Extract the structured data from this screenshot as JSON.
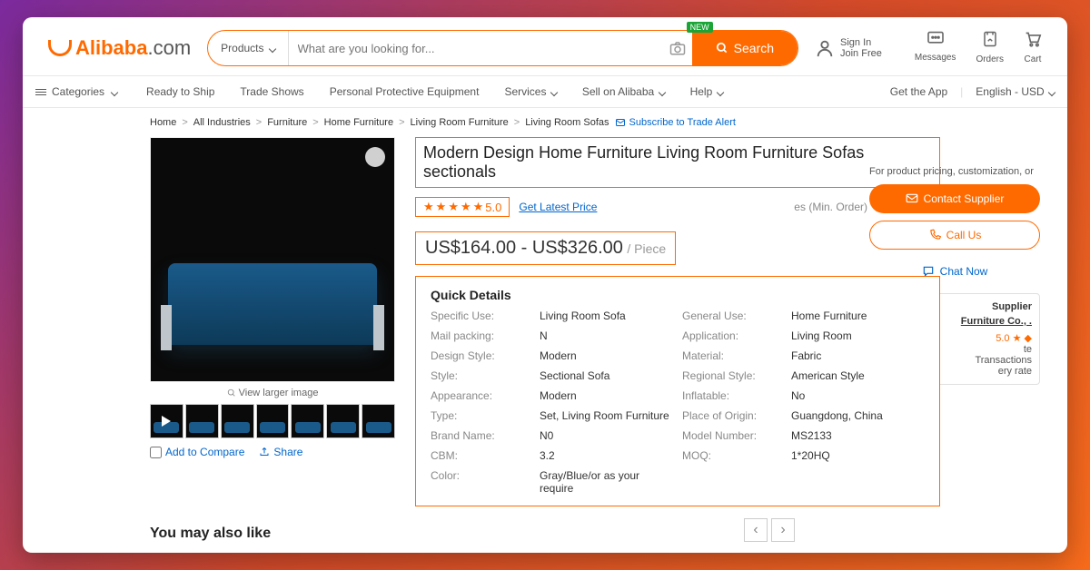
{
  "brand": {
    "name": "Alibaba",
    "tld": ".com"
  },
  "search": {
    "dropdown": "Products",
    "placeholder": "What are you looking for...",
    "button": "Search",
    "new_badge": "NEW"
  },
  "account": {
    "signin": "Sign In",
    "join": "Join Free"
  },
  "toplinks": {
    "messages": "Messages",
    "orders": "Orders",
    "cart": "Cart"
  },
  "nav": {
    "categories": "Categories",
    "items": [
      "Ready to Ship",
      "Trade Shows",
      "Personal Protective Equipment",
      "Services",
      "Sell on Alibaba",
      "Help"
    ],
    "getapp": "Get the App",
    "lang": "English - USD"
  },
  "breadcrumbs": [
    "Home",
    "All Industries",
    "Furniture",
    "Home Furniture",
    "Living Room Furniture",
    "Living Room Sofas"
  ],
  "subscribe": "Subscribe to Trade Alert",
  "product": {
    "title": "Modern Design Home Furniture Living Room Furniture Sofas sectionals",
    "rating": "5.0",
    "get_latest": "Get Latest Price",
    "min_order_suffix": "(Min. Order)",
    "min_order_prefix": "es",
    "price": "US$164.00 - US$326.00",
    "price_unit": "/ Piece",
    "view_larger": "View larger image",
    "compare": "Add to Compare",
    "share": "Share"
  },
  "quick_details": {
    "title": "Quick Details",
    "rows": [
      [
        "Specific Use:",
        "Living Room Sofa",
        "General Use:",
        "Home Furniture"
      ],
      [
        "Mail packing:",
        "N",
        "Application:",
        "Living Room"
      ],
      [
        "Design Style:",
        "Modern",
        "Material:",
        "Fabric"
      ],
      [
        "Style:",
        "Sectional Sofa",
        "Regional Style:",
        "American Style"
      ],
      [
        "Appearance:",
        "Modern",
        "Inflatable:",
        "No"
      ],
      [
        "Type:",
        "Set, Living Room Furniture",
        "Place of Origin:",
        "Guangdong, China"
      ],
      [
        "Brand Name:",
        "N0",
        "Model Number:",
        "MS2133"
      ],
      [
        "CBM:",
        "3.2",
        "MOQ:",
        "1*20HQ"
      ],
      [
        "Color:",
        "Gray/Blue/or as your require",
        "",
        ""
      ]
    ]
  },
  "actions": {
    "note": "For product pricing, customization, or",
    "contact": "Contact Supplier",
    "call": "Call Us",
    "chat": "Chat Now"
  },
  "supplier": {
    "tab": "Supplier",
    "name": "Furniture Co., .",
    "rating": "5.0 ★",
    "l1": "te",
    "l2": "Transactions",
    "l3": "ery rate"
  },
  "footer": {
    "youmay": "You may also like"
  }
}
